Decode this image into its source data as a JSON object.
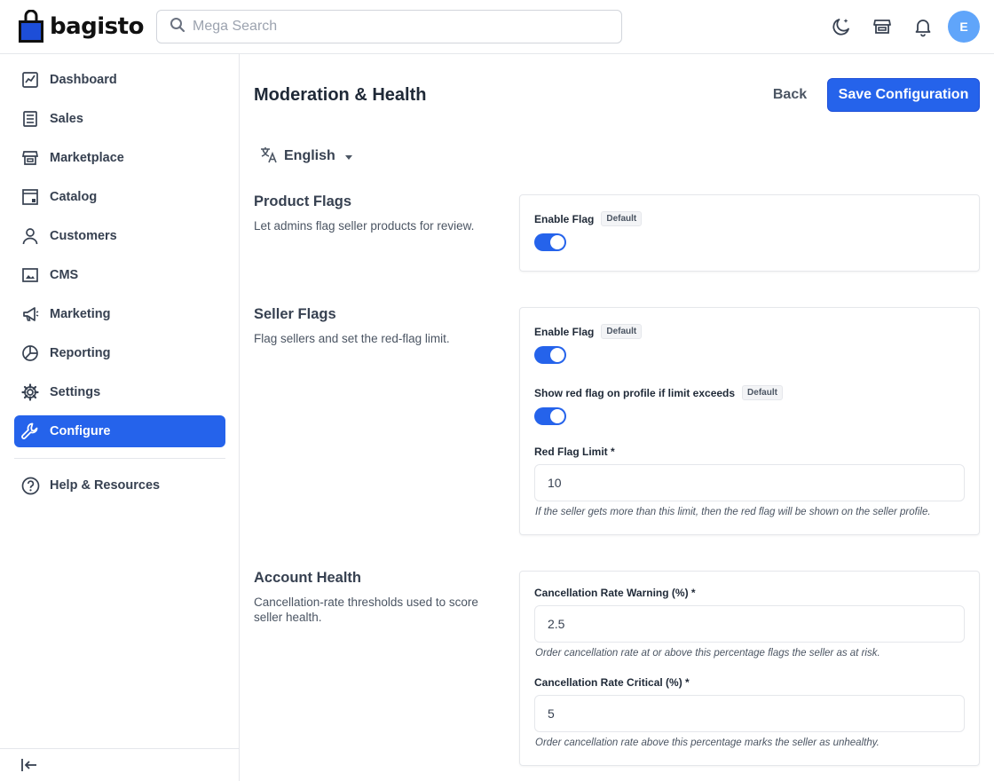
{
  "header": {
    "brand": "bagisto",
    "search_placeholder": "Mega Search",
    "avatar_initial": "E",
    "colors": {
      "accent": "#2563eb",
      "avatar": "#60a5fa"
    }
  },
  "sidebar": {
    "items": [
      {
        "label": "Dashboard",
        "icon": "dashboard-icon"
      },
      {
        "label": "Sales",
        "icon": "sales-icon"
      },
      {
        "label": "Marketplace",
        "icon": "store-icon"
      },
      {
        "label": "Catalog",
        "icon": "catalog-icon"
      },
      {
        "label": "Customers",
        "icon": "customers-icon"
      },
      {
        "label": "CMS",
        "icon": "cms-icon"
      },
      {
        "label": "Marketing",
        "icon": "megaphone-icon"
      },
      {
        "label": "Reporting",
        "icon": "pie-chart-icon"
      },
      {
        "label": "Settings",
        "icon": "gear-icon"
      },
      {
        "label": "Configure",
        "icon": "wrench-icon",
        "active": true
      }
    ],
    "help_label": "Help & Resources"
  },
  "page": {
    "title": "Moderation & Health",
    "back_label": "Back",
    "save_label": "Save Configuration",
    "locale": "English"
  },
  "sections": {
    "product_flags": {
      "title": "Product Flags",
      "description": "Let admins flag seller products for review.",
      "enable_label": "Enable Flag",
      "enable_badge": "Default",
      "enable_on": true
    },
    "seller_flags": {
      "title": "Seller Flags",
      "description": "Flag sellers and set the red-flag limit.",
      "enable_label": "Enable Flag",
      "enable_badge": "Default",
      "enable_on": true,
      "show_red_label": "Show red flag on profile if limit exceeds",
      "show_red_badge": "Default",
      "show_red_on": true,
      "limit_label": "Red Flag Limit *",
      "limit_value": "10",
      "limit_hint": "If the seller gets more than this limit, then the red flag will be shown on the seller profile."
    },
    "account_health": {
      "title": "Account Health",
      "description": "Cancellation-rate thresholds used to score seller health.",
      "warning_label": "Cancellation Rate Warning (%) *",
      "warning_value": "2.5",
      "warning_hint": "Order cancellation rate at or above this percentage flags the seller as at risk.",
      "critical_label": "Cancellation Rate Critical (%) *",
      "critical_value": "5",
      "critical_hint": "Order cancellation rate above this percentage marks the seller as unhealthy."
    }
  }
}
